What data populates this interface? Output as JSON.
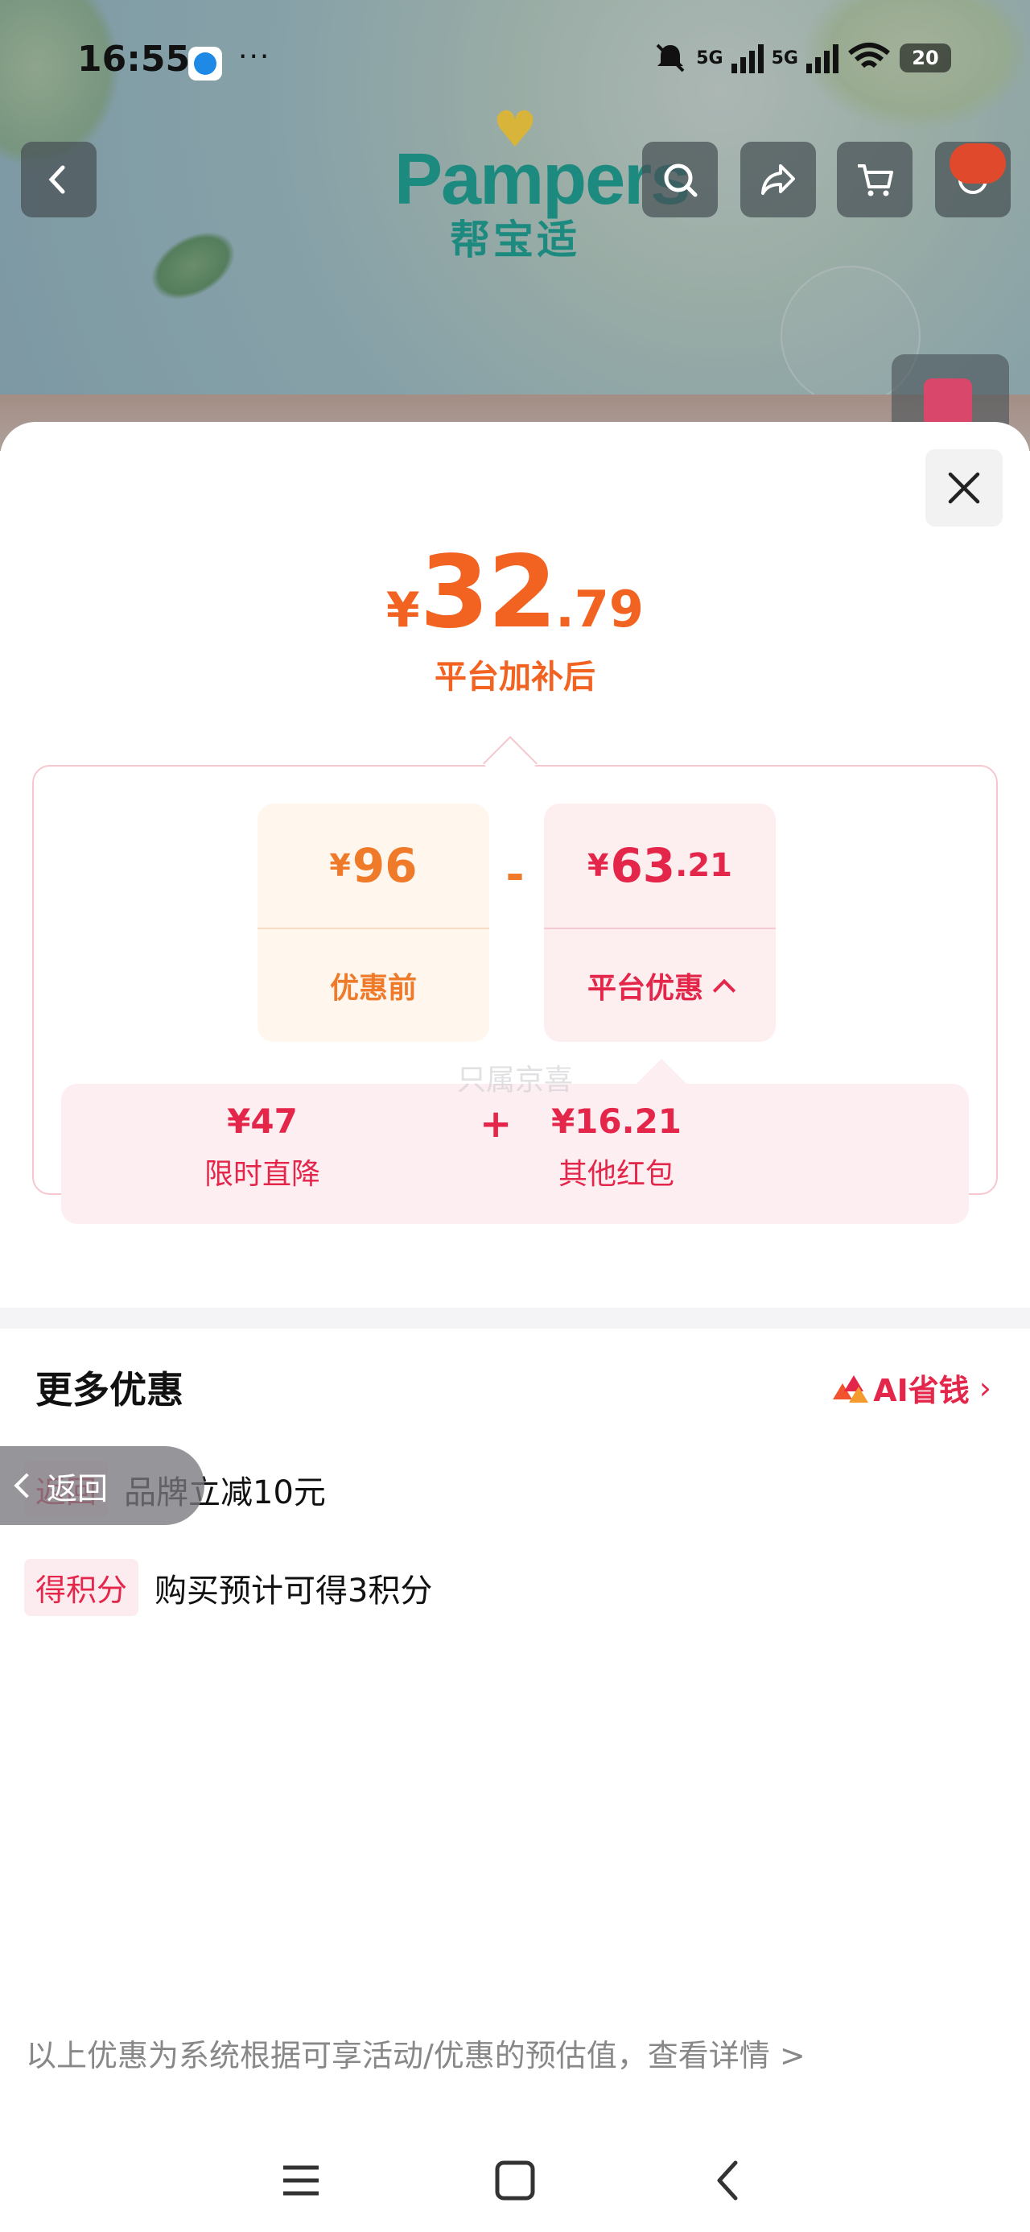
{
  "status_bar": {
    "time": "16:55",
    "more": "···",
    "signal1": "5G",
    "signal2": "5G",
    "battery": "20",
    "icons": [
      "app-icon",
      "mute-icon",
      "signal-icon",
      "wifi-icon",
      "battery-icon"
    ]
  },
  "header": {
    "brand_logo_text": "Pampers",
    "brand_cn": "帮宝适",
    "buttons": [
      "back-icon",
      "search-icon",
      "share-icon",
      "cart-icon",
      "message-icon"
    ]
  },
  "sheet": {
    "price": {
      "currency": "¥",
      "integer": "32",
      "decimal": ".79"
    },
    "price_caption": "平台加补后",
    "original": {
      "currency": "¥",
      "integer": "96",
      "label": "优惠前"
    },
    "minus": "-",
    "discount": {
      "currency": "¥",
      "integer": "63",
      "decimal": ".21",
      "label": "平台优惠"
    },
    "sub": [
      {
        "amount": "¥47",
        "label": "限时直降"
      },
      {
        "amount": "¥16.21",
        "label": "其他红包"
      }
    ],
    "plus": "+",
    "watermark": "只属京喜",
    "more_title": "更多优惠",
    "ai_link": "AI省钱",
    "promos": [
      {
        "tag": "返回",
        "text": "品牌立减10元"
      },
      {
        "tag": "得积分",
        "text": "购买预计可得3积分"
      }
    ],
    "return_pill": "返回",
    "footnote": "以上优惠为系统根据可享活动/优惠的预估值，查看详情 >"
  },
  "colors": {
    "price_orange": "#f26322",
    "discount_red": "#e3264a",
    "brand_teal": "#1d8a80"
  }
}
